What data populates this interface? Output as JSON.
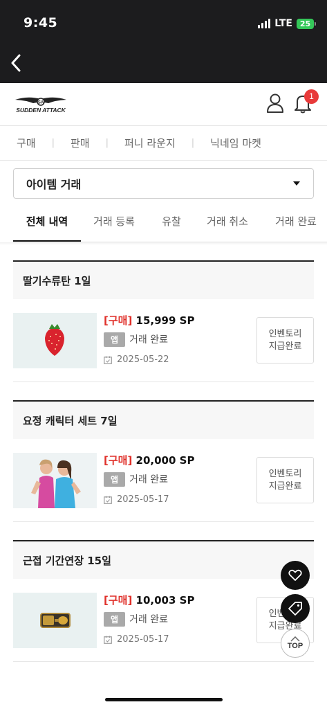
{
  "status_bar": {
    "time": "9:45",
    "network": "LTE",
    "battery": "25"
  },
  "header": {
    "logo_text": "SUDDEN ATTACK",
    "notification_count": "1"
  },
  "main_nav": {
    "items": [
      "구매",
      "판매",
      "퍼니 라운지",
      "닉네임 마켓"
    ]
  },
  "category_select": {
    "value": "아이템 거래"
  },
  "tabs": [
    "전체 내역",
    "거래 등록",
    "유찰",
    "거래 취소",
    "거래 완료"
  ],
  "orders": [
    {
      "title": "딸기수류탄 1일",
      "type_tag": "[구매]",
      "price": "15,999 SP",
      "app_badge": "앱",
      "status": "거래 완료",
      "date": "2025-05-22",
      "action_line1": "인벤토리",
      "action_line2": "지급완료"
    },
    {
      "title": "요정 캐릭터 세트 7일",
      "type_tag": "[구매]",
      "price": "20,000 SP",
      "app_badge": "앱",
      "status": "거래 완료",
      "date": "2025-05-17",
      "action_line1": "인벤토리",
      "action_line2": "지급완료"
    },
    {
      "title": "근접 기간연장 15일",
      "type_tag": "[구매]",
      "price": "10,003 SP",
      "app_badge": "앱",
      "status": "거래 완료",
      "date": "2025-05-17",
      "action_line1": "인벤토리",
      "action_line2": "지급완료"
    }
  ],
  "floating": {
    "top_label": "TOP"
  }
}
